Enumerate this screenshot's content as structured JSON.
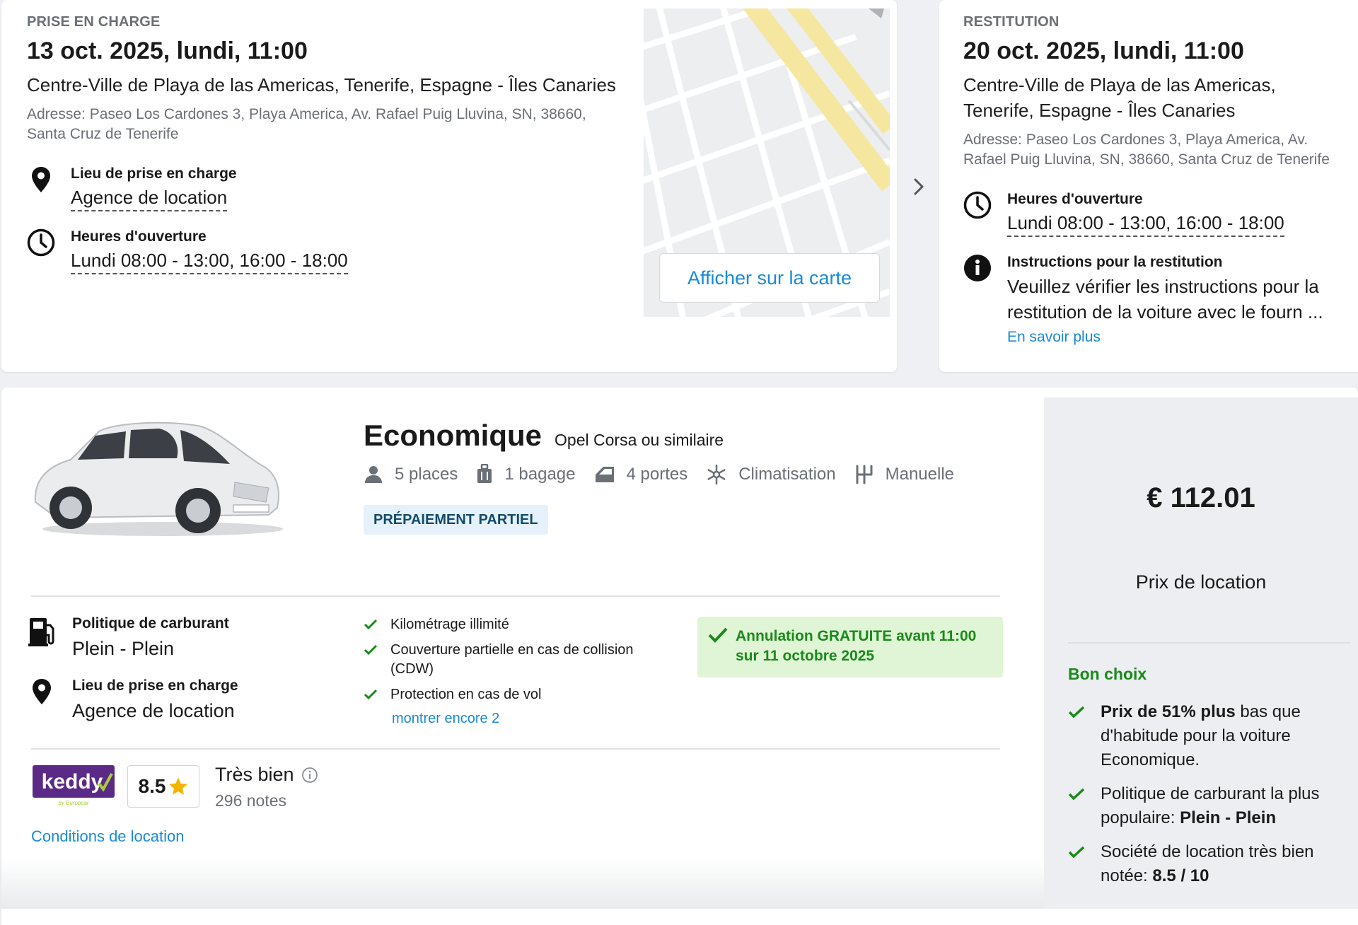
{
  "pickup": {
    "eyebrow": "PRISE EN CHARGE",
    "date": "13 oct. 2025, lundi, 11:00",
    "place": "Centre-Ville de Playa de las Americas, Tenerife, Espagne - Îles Canaries",
    "address": "Adresse: Paseo Los Cardones 3, Playa America, Av. Rafael Puig Lluvina, SN, 38660, Santa Cruz de Tenerife",
    "location_label": "Lieu de prise en charge",
    "location_value": "Agence de location",
    "hours_label": "Heures d'ouverture",
    "hours_value": "Lundi 08:00 - 13:00, 16:00 - 18:00",
    "map_button": "Afficher sur la carte"
  },
  "dropoff": {
    "eyebrow": "RESTITUTION",
    "date": "20 oct. 2025, lundi, 11:00",
    "place": "Centre-Ville de Playa de las Americas, Tenerife, Espagne - Îles Canaries",
    "address": "Adresse: Paseo Los Cardones 3, Playa America, Av. Rafael Puig Lluvina, SN, 38660, Santa Cruz de Tenerife",
    "hours_label": "Heures d'ouverture",
    "hours_value": "Lundi 08:00 - 13:00, 16:00 - 18:00",
    "instructions_label": "Instructions pour la restitution",
    "instructions_value": "Veuillez vérifier les instructions pour la restitution de la voiture avec le fourn ...",
    "more_link": "En savoir plus"
  },
  "car": {
    "class": "Economique",
    "model": "Opel Corsa ou similaire",
    "specs": {
      "seats": "5 places",
      "bags": "1 bagage",
      "doors": "4 portes",
      "ac": "Climatisation",
      "gearbox": "Manuelle"
    },
    "badge": "PRÉPAIEMENT PARTIEL",
    "color": "#e8e9ea"
  },
  "fuel": {
    "label": "Politique de carburant",
    "value": "Plein - Plein"
  },
  "pickup_location": {
    "label": "Lieu de prise en charge",
    "value": "Agence de location"
  },
  "inclusions": {
    "items": [
      "Kilométrage illimité",
      "Couverture partielle en cas de collision (CDW)",
      "Protection en cas de vol"
    ],
    "more_link": "montrer encore 2"
  },
  "free_cancellation": "Annulation GRATUITE avant 11:00 sur 11 octobre 2025",
  "supplier": {
    "logo_text": "keddy",
    "logo_sub": "by Europcar",
    "score": "8.5",
    "rating_label": "Très bien",
    "reviews": "296 notes",
    "terms_link": "Conditions de location"
  },
  "price_panel": {
    "price": "€ 112.01",
    "label": "Prix de location",
    "good_choice": "Bon choix",
    "reasons": [
      {
        "strong": "Prix de 51% plus",
        "rest": " bas que d'habitude pour la voiture Economique."
      },
      {
        "pre": "Politique de carburant la plus populaire: ",
        "strong": "Plein - Plein"
      },
      {
        "pre": "Société de location très bien notée: ",
        "strong": "8.5 / 10"
      }
    ]
  },
  "colors": {
    "link": "#1a8ad4",
    "success": "#1a8a1a",
    "success_bg": "#dff5d6",
    "badge_bg": "#e6f2fb",
    "keddy_purple": "#5b2a86",
    "keddy_green": "#a6ce39",
    "star": "#f5b301"
  }
}
